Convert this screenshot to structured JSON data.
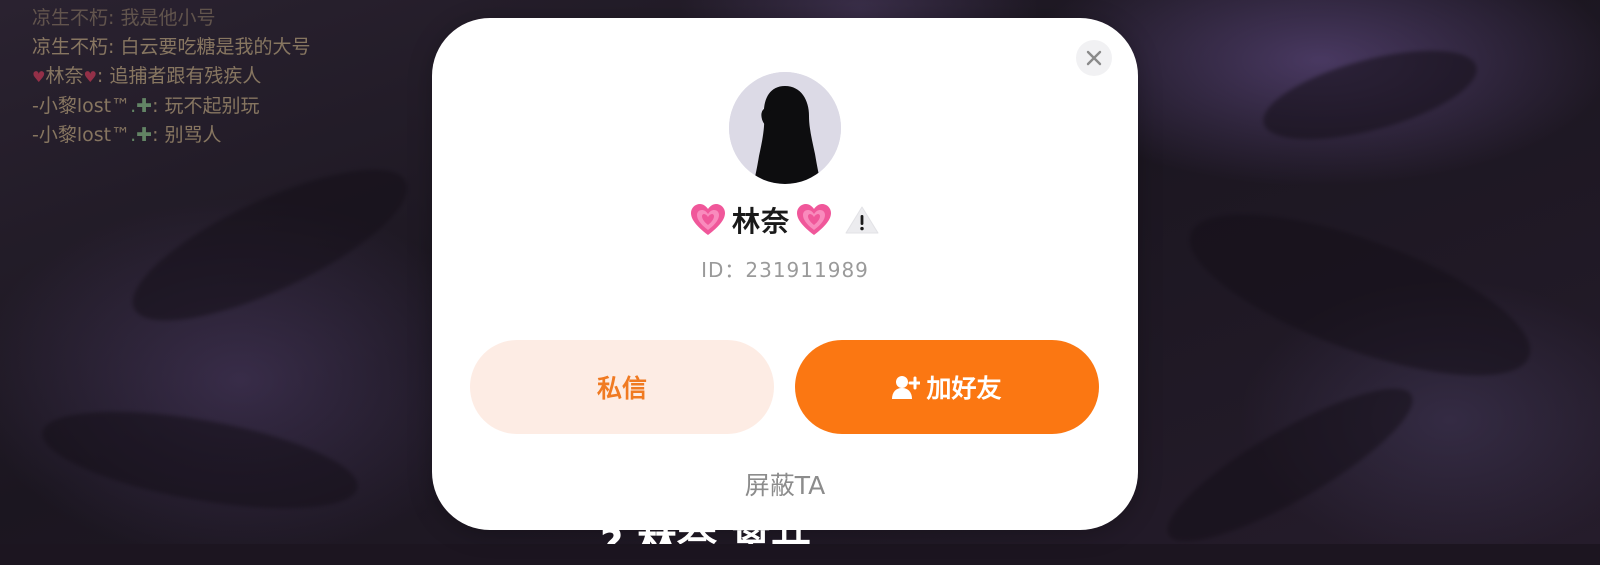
{
  "chat": {
    "messages": [
      {
        "user": "凉生不朽",
        "text": "我是他小号"
      },
      {
        "user": "凉生不朽",
        "text": "白云要吃糖是我的大号"
      },
      {
        "user": "林奈",
        "text": "追捕者跟有残疾人"
      },
      {
        "user": "-小黎lost™",
        "text": "玩不起别玩"
      },
      {
        "user": "-小黎lost™",
        "text": "别骂人"
      }
    ]
  },
  "profile": {
    "name": "林奈",
    "id_text": "ID：231911989",
    "name_icons": [
      "heart-icon",
      "heart-icon",
      "warning-icon"
    ]
  },
  "actions": {
    "message_label": "私信",
    "add_friend_label": "加好友",
    "block_label": "屏蔽TA"
  },
  "colors": {
    "accent": "#fb7712",
    "accent_light": "#fdece4",
    "modal_bg": "#ffffff",
    "heart": "#f0579a"
  },
  "footer": {
    "partial_text": "? 林奈 离开"
  }
}
